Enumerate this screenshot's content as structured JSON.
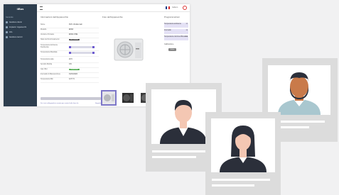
{
  "app": {
    "brand": "iiBus",
    "nav_heading": "Generale",
    "nav_items": [
      "Gestione clienti",
      "Impianti / Apparecchi",
      "Info",
      "Gestione tecnici"
    ],
    "language": "Italiano",
    "colors": {
      "sidebar": "#2e3e4e",
      "accent": "#6d5bd0",
      "danger": "#dd3333"
    }
  },
  "info_panel": {
    "title": "Informazioni dell'Apparecchio",
    "fields": [
      {
        "label": "Nome",
        "value": "DVC clit alla main"
      },
      {
        "label": "Modello",
        "value": "EFAN"
      },
      {
        "label": "Versione firmware",
        "value": "EFAN-ONE"
      },
      {
        "label": "Stato del Funzionamento",
        "value": "Accendibile"
      },
      {
        "label": "Temperatura Ambiente Desiderata",
        "value": "22"
      },
      {
        "label": "Temperatura Mandata",
        "value": "27.5"
      },
      {
        "label": "Temperatura sala",
        "value": "20.5"
      },
      {
        "label": "Servizio Mobile",
        "value": "ON"
      },
      {
        "label": "Gas rifiut",
        "value": "Disponibile"
      },
      {
        "label": "Intervallo di Manutenzione",
        "value": "01/01/2022"
      },
      {
        "label": "Temperatura Min",
        "value": "12.5 °C"
      }
    ],
    "save_label": "Salva",
    "notice": "Se ti stai collegando in remoto per conto di altri fare clic",
    "notice_link": "Segnala"
  },
  "image_panel": {
    "title": "Foto dell'Apparecchio"
  },
  "right_panel": {
    "title": "Programmazioni",
    "rows": [
      {
        "label": "Temperatura ambiente",
        "value": "22"
      },
      {
        "label": "Intervallo",
        "value": "23"
      },
      {
        "label": "Temperatura minima differenza",
        "value": "12.0"
      }
    ],
    "note": "Calibrazione",
    "button": "Salva"
  }
}
